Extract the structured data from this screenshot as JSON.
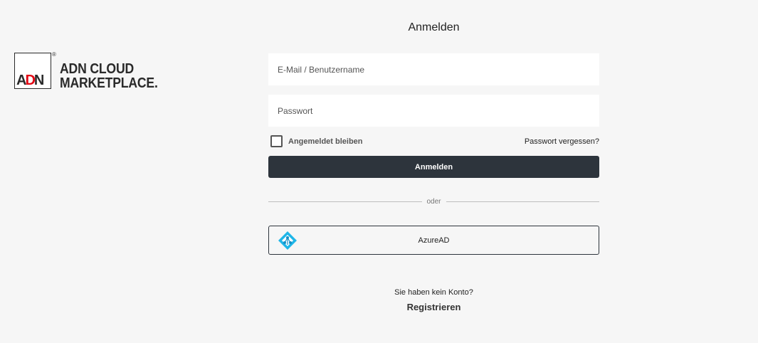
{
  "logo": {
    "mark_text_a": "A",
    "mark_text_d": "D",
    "mark_text_n": "N",
    "registered": "®",
    "line1": "ADN CLOUD",
    "line2": "MARKETPLACE."
  },
  "form": {
    "title": "Anmelden",
    "email_placeholder": "E-Mail / Benutzername",
    "email_value": "",
    "password_placeholder": "Passwort",
    "password_value": "",
    "remember_label": "Angemeldet bleiben",
    "remember_checked": false,
    "forgot_label": "Passwort vergessen?",
    "submit_label": "Anmelden",
    "divider_label": "oder",
    "azure_label": "AzureAD",
    "no_account_text": "Sie haben kein Konto?",
    "register_label": "Registrieren"
  },
  "colors": {
    "background": "#f6f6f6",
    "primary_button": "#2d343c",
    "logo_accent": "#e30613",
    "azure_accent": "#1fb6e8"
  },
  "icons": {
    "azure": "azure-ad-icon",
    "checkbox": "checkbox-icon"
  }
}
